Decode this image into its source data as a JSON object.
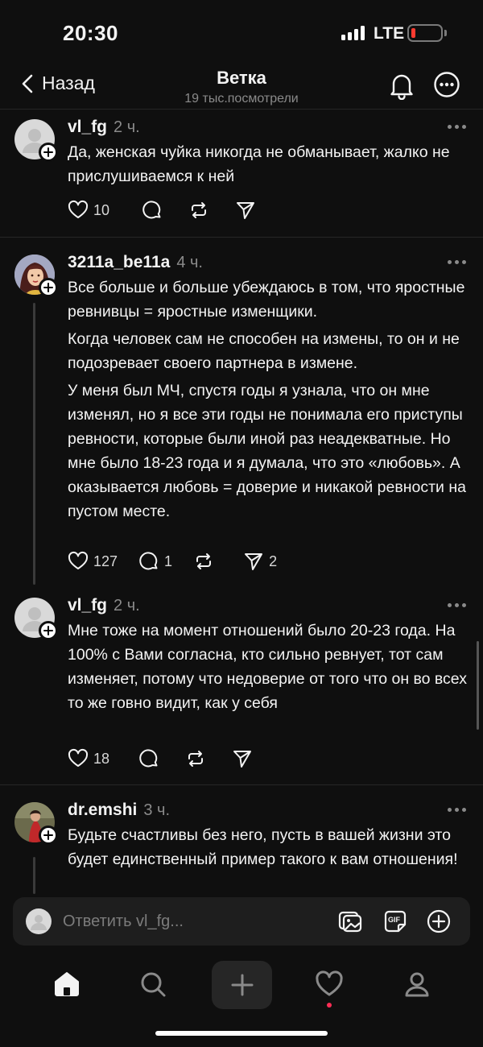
{
  "status_bar": {
    "time": "20:30",
    "network": "LTE"
  },
  "header": {
    "back_label": "Назад",
    "title": "Ветка",
    "subtitle": "19 тыс.посмотрели"
  },
  "posts": [
    {
      "username": "vl_fg",
      "time": "2 ч.",
      "paragraphs": [
        "Да, женская чуйка никогда не обманывает, жалко не прислушиваемся к ней"
      ],
      "likes": "10",
      "comments": "",
      "reposts": "",
      "shares": ""
    },
    {
      "username": "3211a_be11a",
      "time": "4 ч.",
      "paragraphs": [
        "Все больше и больше убеждаюсь в том, что яростные ревнивцы = яростные изменщики.",
        "Когда человек сам не способен на измены, то он и не подозревает своего партнера в измене.",
        "У меня был МЧ, спустя годы я узнала, что он мне изменял, но я все эти годы не понимала его приступы ревности, которые были иной раз неадекватные. Но мне было 18-23 года и я думала, что это «любовь». А оказывается любовь = доверие и никакой ревности на пустом месте."
      ],
      "likes": "127",
      "comments": "1",
      "reposts": "",
      "shares": "2"
    },
    {
      "username": "vl_fg",
      "time": "2 ч.",
      "paragraphs": [
        "Мне тоже на момент отношений было 20-23 года. На 100% с Вами согласна, кто сильно ревнует, тот сам изменяет, потому что недоверие от того что он во всех то же говно видит, как у себя"
      ],
      "likes": "18",
      "comments": "",
      "reposts": "",
      "shares": ""
    },
    {
      "username": "dr.emshi",
      "time": "3 ч.",
      "paragraphs": [
        "Будьте счастливы без него, пусть в вашей жизни это будет единственный пример такого к вам отношения!"
      ],
      "likes": "",
      "comments": "",
      "reposts": "",
      "shares": ""
    }
  ],
  "reply_bar": {
    "placeholder": "Ответить vl_fg..."
  },
  "colors": {
    "background": "#0f0f0f",
    "text": "#f3f3f3",
    "muted": "#8a8a8a",
    "notification_dot": "#ff2d55",
    "battery_low": "#ff3b30"
  },
  "icons": {
    "header": [
      "chevron-left-icon",
      "bell-icon",
      "more-circle-icon"
    ],
    "post_actions": [
      "heart-icon",
      "comment-icon",
      "repost-icon",
      "send-icon"
    ],
    "reply_bar": [
      "image-icon",
      "gif-icon",
      "plus-circle-icon"
    ],
    "nav": [
      "home-icon",
      "search-icon",
      "plus-icon",
      "heart-icon",
      "profile-icon"
    ]
  }
}
